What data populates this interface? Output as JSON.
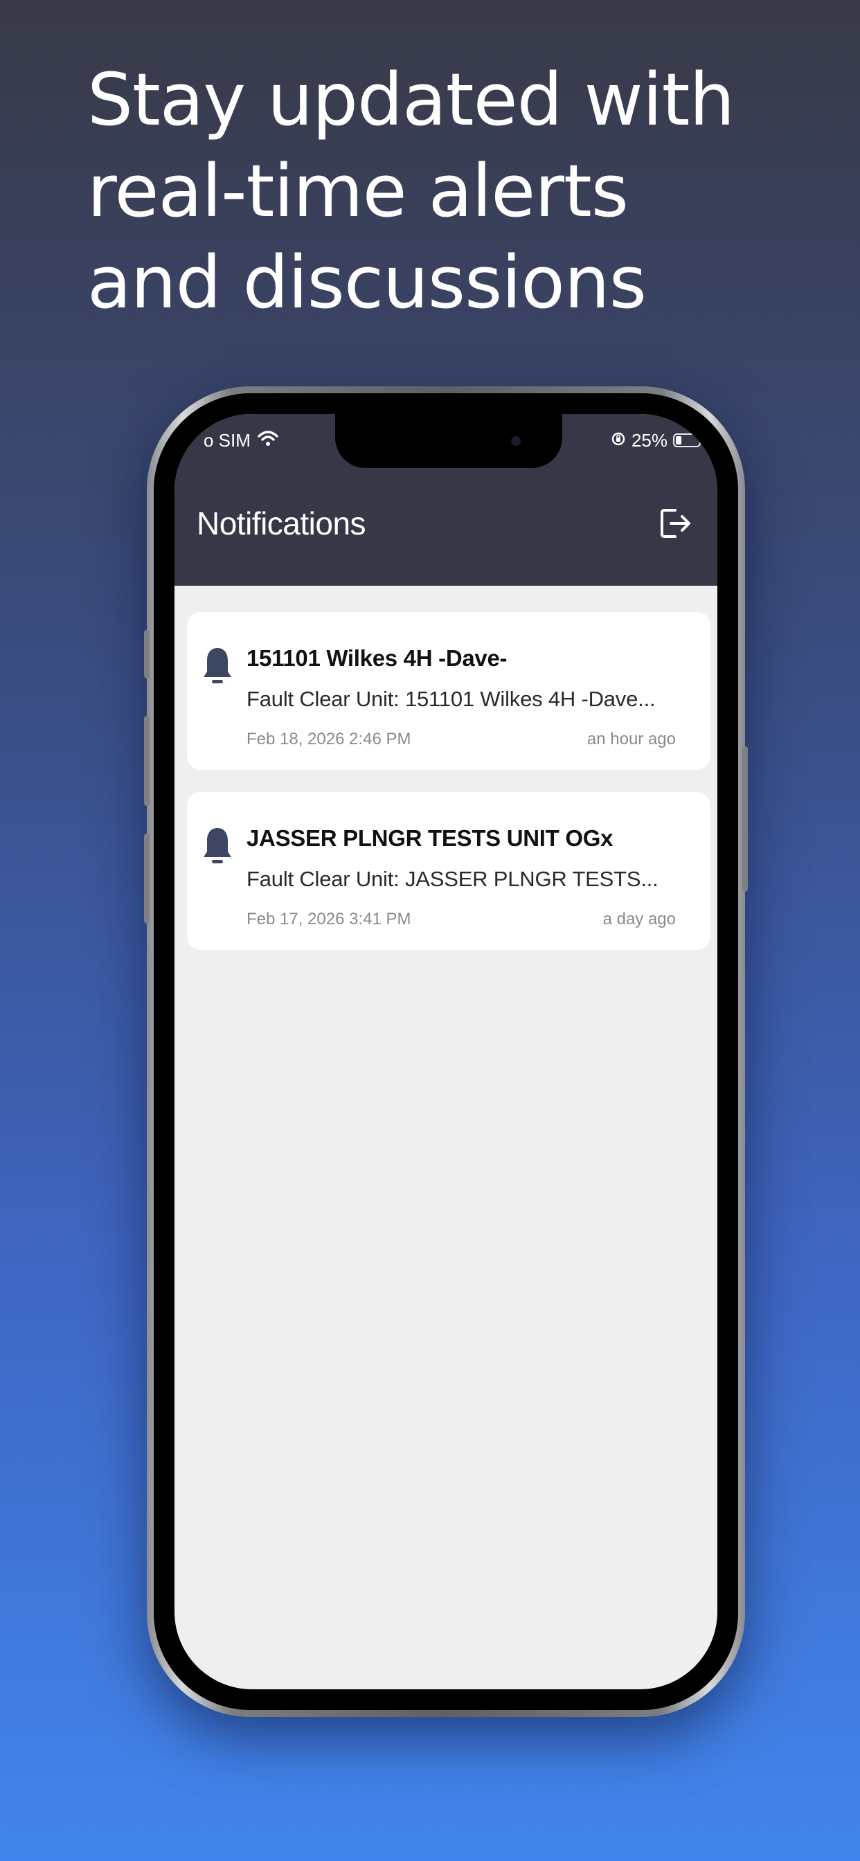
{
  "headline": {
    "line1": "Stay updated with",
    "line2": "real-time alerts",
    "line3": "and discussions"
  },
  "status_bar": {
    "carrier": "o SIM",
    "battery_percent": "25%",
    "battery_level": 0.25,
    "icons": [
      "wifi-icon",
      "orientation-lock-icon",
      "battery-icon"
    ]
  },
  "app_bar": {
    "title": "Notifications",
    "action_icon": "logout-icon"
  },
  "notifications": [
    {
      "title": "151101 Wilkes 4H -Dave-",
      "body": "Fault Clear Unit: 151101 Wilkes 4H -Dave...",
      "date": "Feb 18, 2026 2:46 PM",
      "relative": "an hour ago",
      "icon": "bell-icon"
    },
    {
      "title": "JASSER PLNGR TESTS UNIT OGx",
      "body": "Fault Clear Unit: JASSER PLNGR TESTS...",
      "date": "Feb 17, 2026 3:41 PM",
      "relative": "a day ago",
      "icon": "bell-icon"
    }
  ],
  "colors": {
    "app_bar": "#363848",
    "bell": "#3d4663",
    "list_background": "#efefef",
    "card": "#ffffff",
    "background_top": "#383a47",
    "background_bottom": "#4285ec"
  }
}
